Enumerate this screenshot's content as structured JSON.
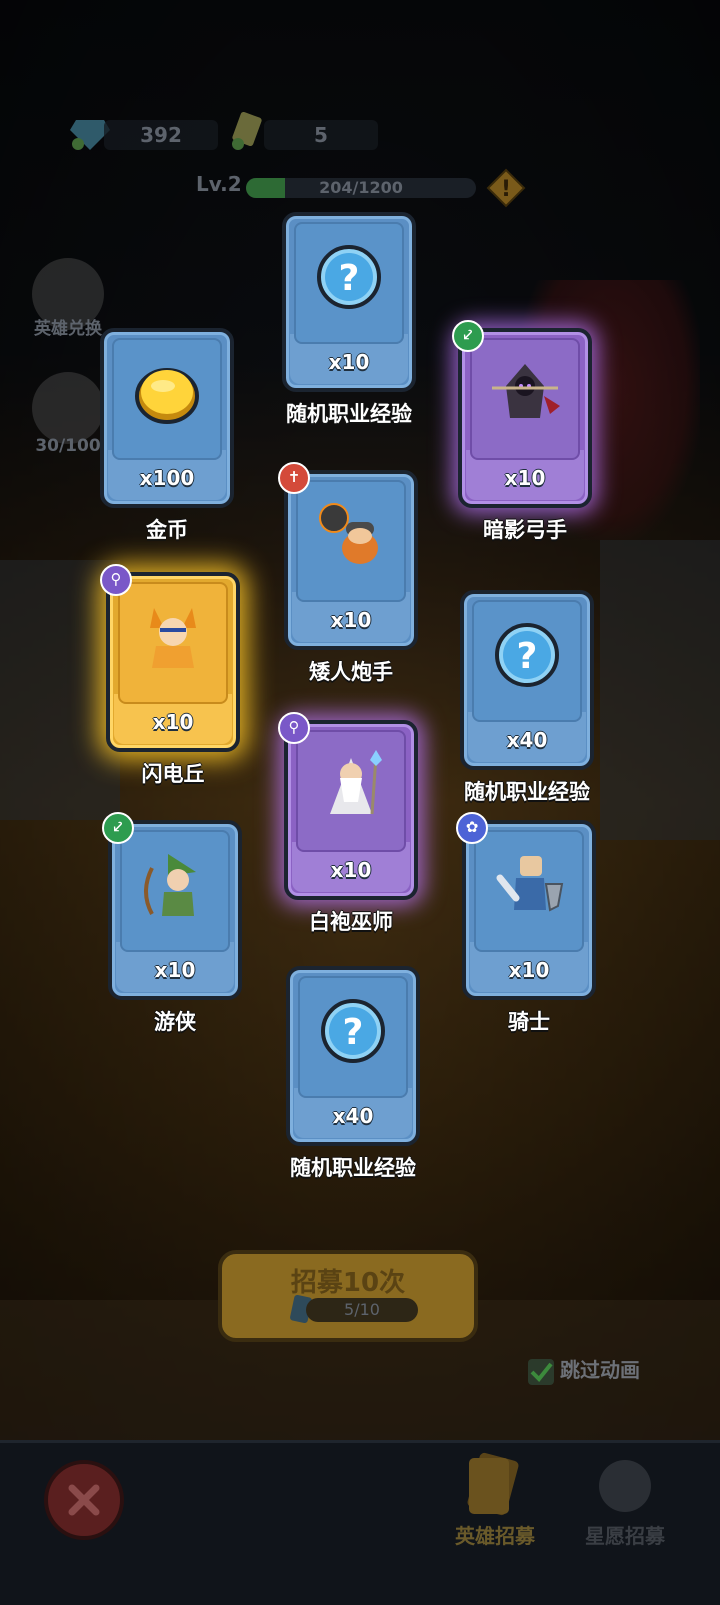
{
  "currency": {
    "gems": "392",
    "tickets": "5"
  },
  "level": {
    "label": "Lv.2",
    "xp_text": "204/1200",
    "xp_fraction": 0.17
  },
  "side_buttons": [
    {
      "label": "英雄兑换"
    },
    {
      "label": "30/100"
    }
  ],
  "cards": [
    {
      "id": "exp1",
      "qty": "x10",
      "name": "随机职业经验",
      "rarity": "blue",
      "art": "question-orb-icon",
      "badge": null
    },
    {
      "id": "shadow-archer",
      "qty": "x10",
      "name": "暗影弓手",
      "rarity": "purple",
      "art": "hooded-archer-icon",
      "badge": "bow-class-icon"
    },
    {
      "id": "gold",
      "qty": "x100",
      "name": "金币",
      "rarity": "blue",
      "art": "gold-coin-icon",
      "badge": null
    },
    {
      "id": "dwarf-gunner",
      "qty": "x10",
      "name": "矮人炮手",
      "rarity": "blue",
      "art": "dwarf-bomber-icon",
      "badge": "cross-class-icon"
    },
    {
      "id": "lightning",
      "qty": "x10",
      "name": "闪电丘",
      "rarity": "gold",
      "art": "fox-girl-icon",
      "badge": "staff-class-icon"
    },
    {
      "id": "exp2",
      "qty": "x40",
      "name": "随机职业经验",
      "rarity": "blue",
      "art": "question-orb-icon",
      "badge": null
    },
    {
      "id": "white-wizard",
      "qty": "x10",
      "name": "白袍巫师",
      "rarity": "purple",
      "art": "old-wizard-icon",
      "badge": "staff-class-icon"
    },
    {
      "id": "ranger",
      "qty": "x10",
      "name": "游侠",
      "rarity": "blue",
      "art": "green-archer-icon",
      "badge": "bow-class-icon"
    },
    {
      "id": "knight",
      "qty": "x10",
      "name": "骑士",
      "rarity": "blue",
      "art": "sword-knight-icon",
      "badge": "paw-class-icon"
    },
    {
      "id": "exp3",
      "qty": "x40",
      "name": "随机职业经验",
      "rarity": "blue",
      "art": "question-orb-icon",
      "badge": null
    }
  ],
  "recruit": {
    "title": "招募10次",
    "progress": "5/10"
  },
  "skip_animation": {
    "label": "跳过动画",
    "checked": true
  },
  "nav": {
    "hero_recruit": "英雄招募",
    "wish_recruit": "星愿招募"
  },
  "colors": {
    "blue_card": "#5b8fc4",
    "purple_card": "#8b62c4",
    "gold_card": "#e2a92e"
  }
}
